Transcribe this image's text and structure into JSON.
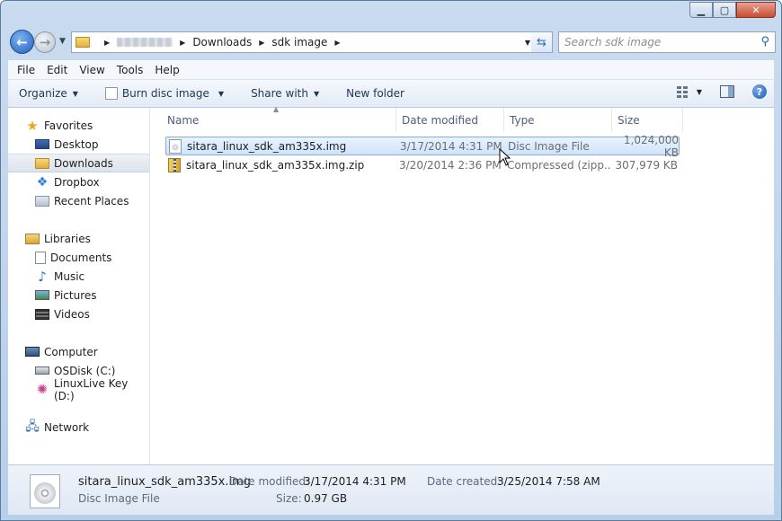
{
  "window": {
    "caption_buttons": [
      "minimize",
      "maximize",
      "close"
    ]
  },
  "address": {
    "crumbs": [
      "Downloads",
      "sdk image"
    ],
    "search_placeholder": "Search sdk image"
  },
  "menu": [
    "File",
    "Edit",
    "View",
    "Tools",
    "Help"
  ],
  "commands": {
    "organize": "Organize",
    "burn": "Burn disc image",
    "share": "Share with",
    "new_folder": "New folder"
  },
  "nav": {
    "favorites": "Favorites",
    "desktop": "Desktop",
    "downloads": "Downloads",
    "dropbox": "Dropbox",
    "recent": "Recent Places",
    "libraries": "Libraries",
    "documents": "Documents",
    "music": "Music",
    "pictures": "Pictures",
    "videos": "Videos",
    "computer": "Computer",
    "osdisk": "OSDisk (C:)",
    "linuxlive": "LinuxLive Key (D:)",
    "network": "Network"
  },
  "columns": {
    "name": "Name",
    "date": "Date modified",
    "type": "Type",
    "size": "Size"
  },
  "files": [
    {
      "name": "sitara_linux_sdk_am335x.img",
      "date": "3/17/2014 4:31 PM",
      "type": "Disc Image File",
      "size": "1,024,000 KB"
    },
    {
      "name": "sitara_linux_sdk_am335x.img.zip",
      "date": "3/20/2014 2:36 PM",
      "type": "Compressed (zipp...",
      "size": "307,979 KB"
    }
  ],
  "details": {
    "name": "sitara_linux_sdk_am335x.img",
    "type": "Disc Image File",
    "modified_label": "Date modified:",
    "modified_value": "3/17/2014 4:31 PM",
    "size_label": "Size:",
    "size_value": "0.97 GB",
    "created_label": "Date created:",
    "created_value": "3/25/2014 7:58 AM"
  }
}
